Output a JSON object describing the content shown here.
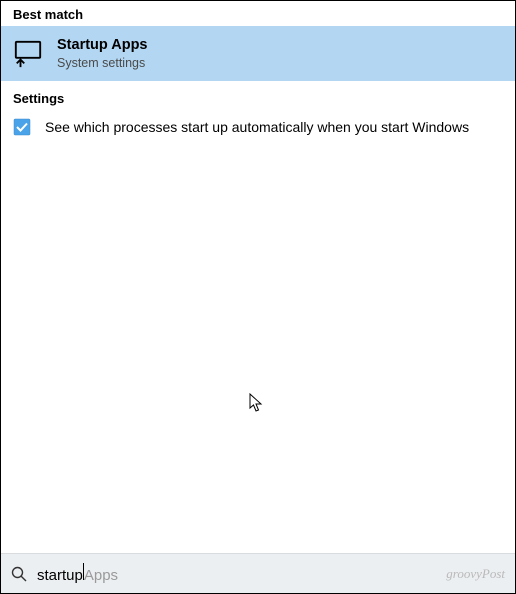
{
  "sections": {
    "best_match_header": "Best match",
    "settings_header": "Settings"
  },
  "best_match": {
    "title": "Startup Apps",
    "subtitle": "System settings",
    "icon": "monitor-arrow-up-icon"
  },
  "settings_results": [
    {
      "icon": "settings-checkbox-icon",
      "label": "See which processes start up automatically when you start Windows"
    }
  ],
  "search": {
    "typed": "startup",
    "suggestion": "Apps",
    "icon": "search-icon"
  },
  "watermark": "groovyPost",
  "colors": {
    "highlight": "#b3d7f2",
    "searchbar": "#eceff1"
  }
}
